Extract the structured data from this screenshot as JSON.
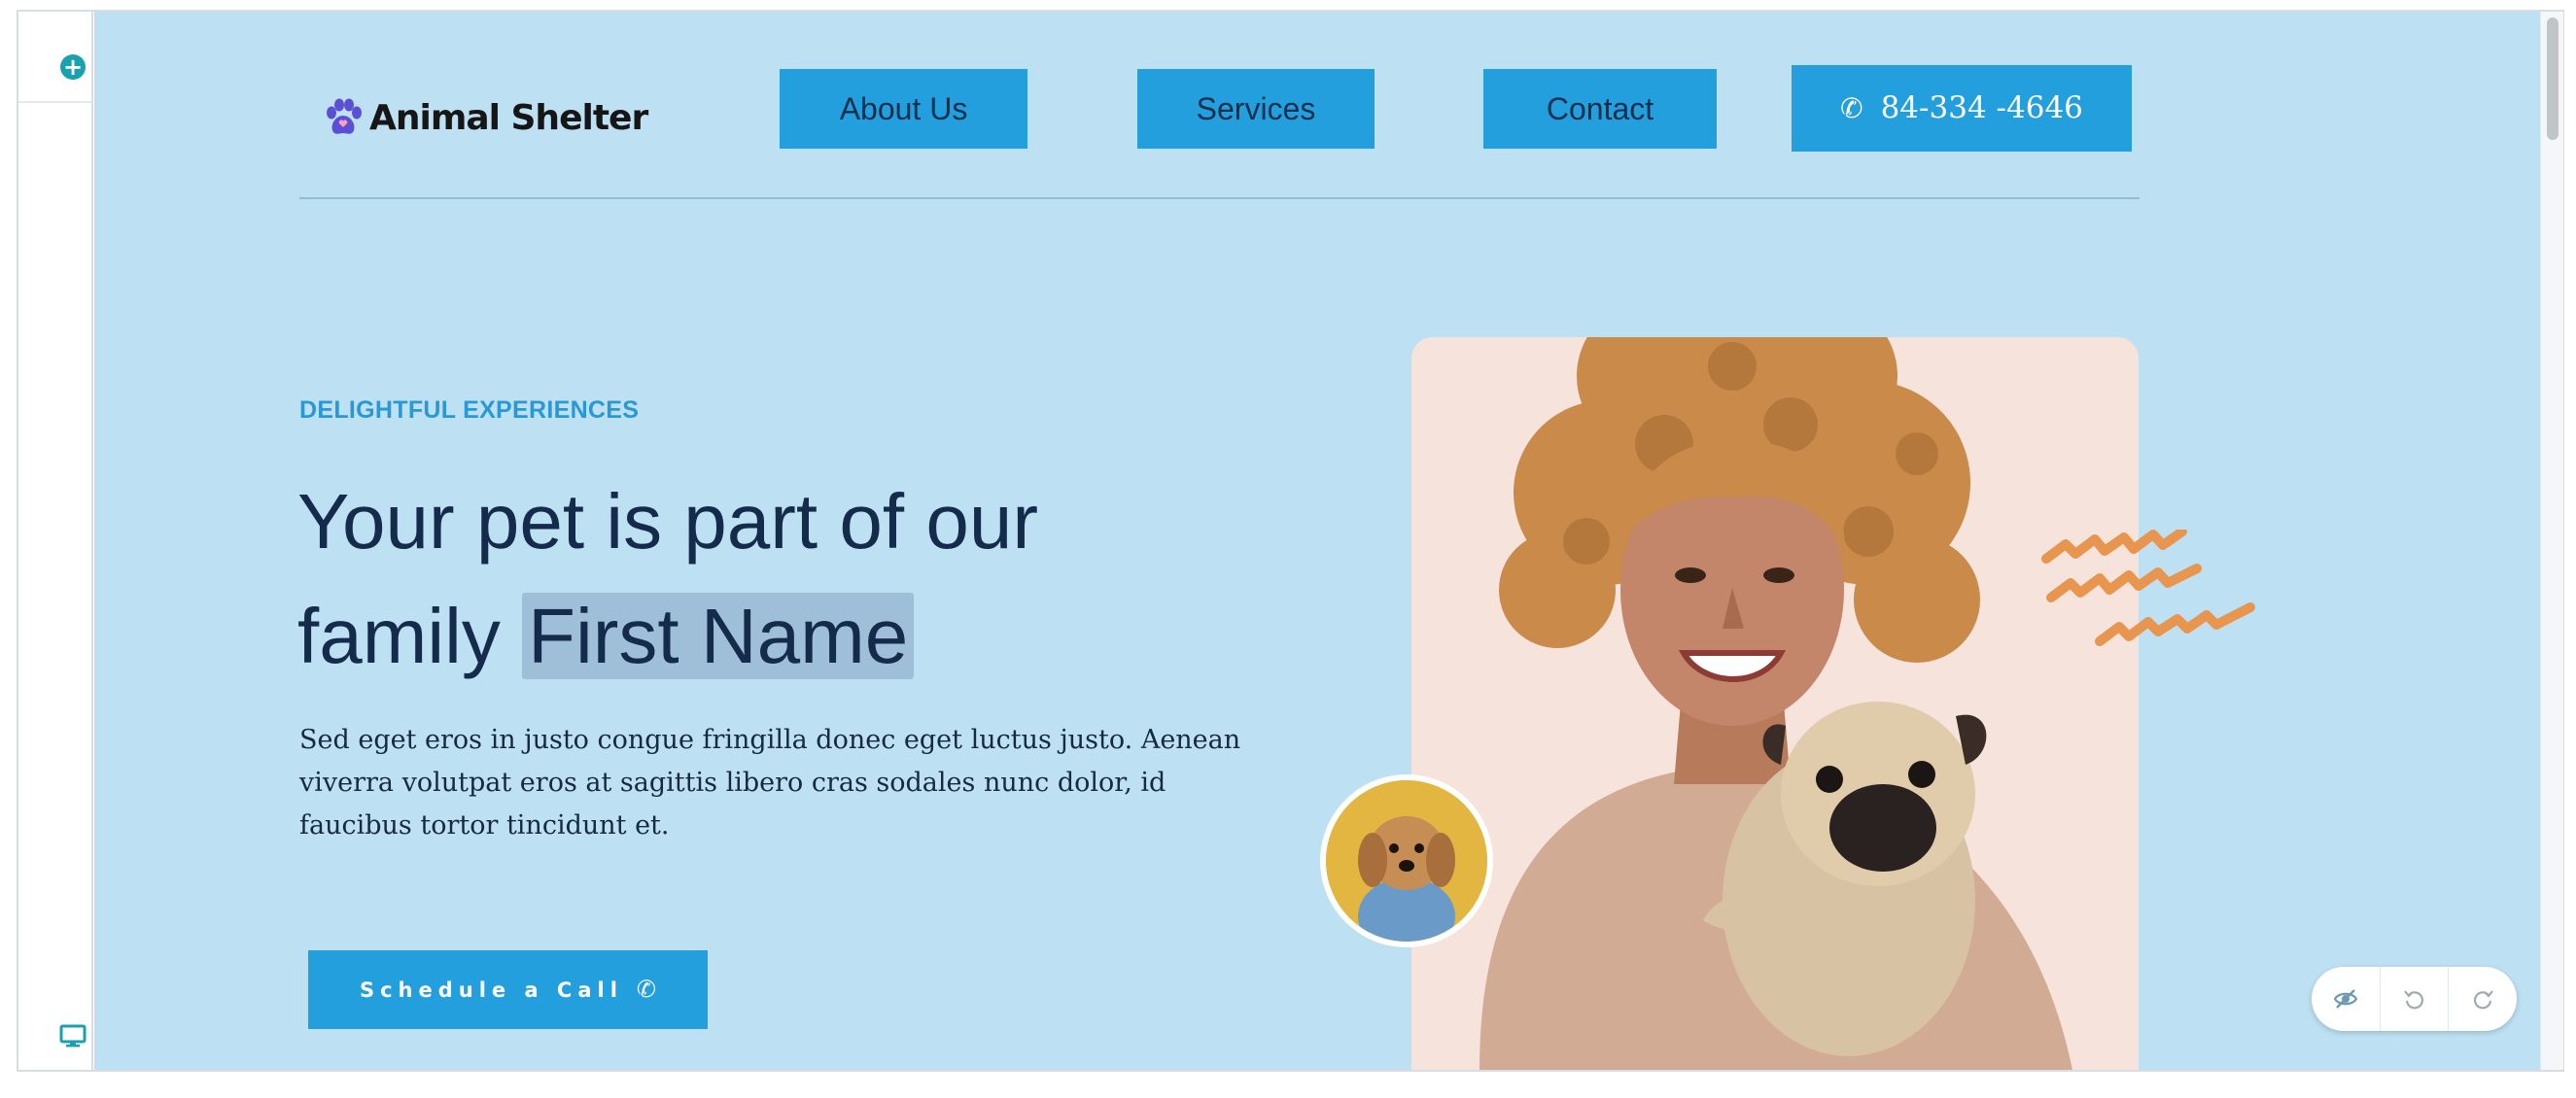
{
  "editor": {
    "add_icon": "plus-circle-icon",
    "device_icon": "desktop-monitor-icon",
    "controls": [
      "hide-icon",
      "undo-icon",
      "redo-icon"
    ]
  },
  "header": {
    "logo_text": "Animal Shelter",
    "nav": [
      "About Us",
      "Services",
      "Contact"
    ],
    "phone": "84-334 -4646"
  },
  "hero": {
    "eyebrow": "DELIGHTFUL EXPERIENCES",
    "headline_line1": "Your pet is part of our",
    "headline_line2_prefix": "family ",
    "headline_highlight": "First Name",
    "lead": "Sed eget eros in justo congue fringilla donec eget luctus justo. Aenean viverra volutpat eros at sagittis libero cras sodales nunc dolor, id faucibus tortor tincidunt et.",
    "cta_label": "Schedule a Call"
  },
  "colors": {
    "canvas_bg": "#bde0f3",
    "button_blue": "#249fde",
    "eyebrow_blue": "#2a98d5",
    "headline": "#152b4b",
    "squiggle": "#e8964f",
    "logo_paw": "#5b4fd6"
  }
}
